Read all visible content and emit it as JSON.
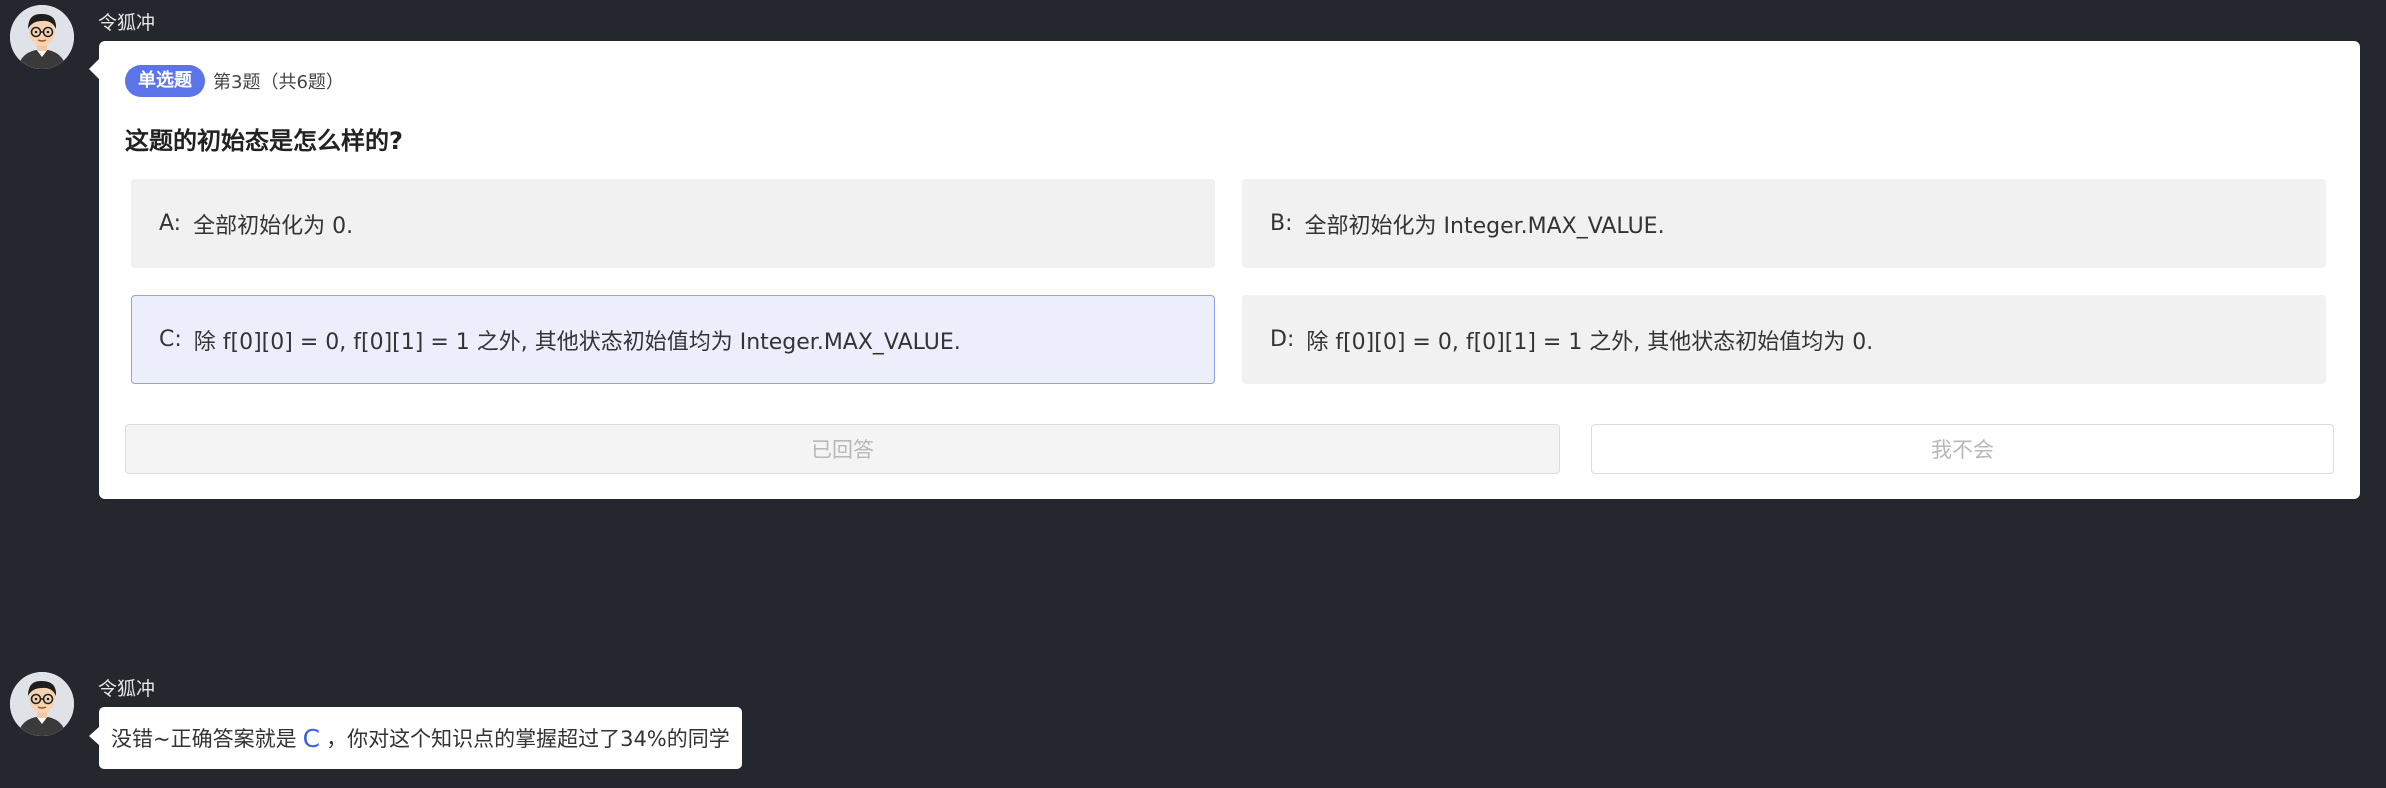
{
  "messages": [
    {
      "username": "令狐冲"
    },
    {
      "username": "令狐冲"
    }
  ],
  "quiz": {
    "type_badge": "单选题",
    "index": "第3题（共6题）",
    "question": "这题的初始态是怎么样的?",
    "options": [
      {
        "key": "A:",
        "text": "全部初始化为 0."
      },
      {
        "key": "B:",
        "text": "全部初始化为 Integer.MAX_VALUE."
      },
      {
        "key": "C:",
        "text": "除 f[0][0] = 0, f[0][1] = 1 之外, 其他状态初始值均为 Integer.MAX_VALUE."
      },
      {
        "key": "D:",
        "text": "除 f[0][0] = 0, f[0][1] = 1 之外, 其他状态初始值均为 0."
      }
    ],
    "selected_option": "C",
    "answered_label": "已回答",
    "dont_know_label": "我不会"
  },
  "reply": {
    "prefix": "没错~正确答案就是",
    "answer": "C",
    "suffix": "，你对这个知识点的掌握超过了34%的同学"
  },
  "colors": {
    "background": "#25272e",
    "badge": "#5b74e8",
    "selected_border": "#8fa3e8",
    "answer_letter": "#3a62e0"
  }
}
